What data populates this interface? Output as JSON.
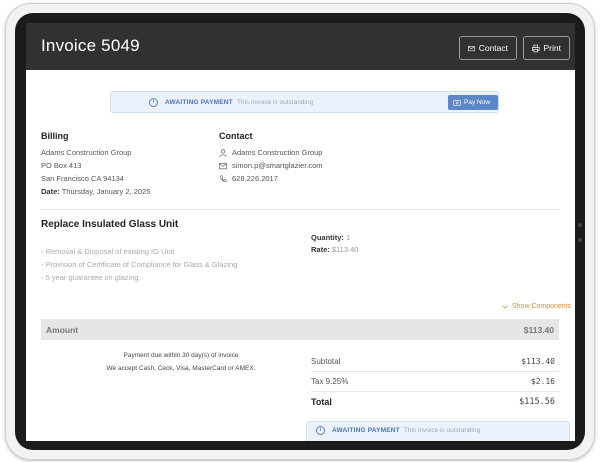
{
  "header": {
    "title": "Invoice 5049",
    "contact_label": "Contact",
    "print_label": "Print"
  },
  "status_banner": {
    "status": "AWAITING PAYMENT",
    "description": "This invoice is outstanding",
    "pay_label": "Pay Now"
  },
  "billing": {
    "heading": "Billing",
    "name": "Adams Construction Group",
    "address1": "PO Box 413",
    "address2": "San Francisco CA 94134",
    "date_label": "Date:",
    "date_value": "Thursday, January 2, 2025"
  },
  "contact": {
    "heading": "Contact",
    "company": "Adams Construction Group",
    "email": "simon.p@smartglazier.com",
    "phone": "628.226.2017"
  },
  "line_item": {
    "title": "Replace Insulated Glass Unit",
    "descriptions": [
      "- Removal & Disposal of existing IG Unit",
      "- Provision of Certificate of Compliance for Glass & Glazing",
      "- 5 year guarantee on glazing"
    ],
    "quantity_label": "Quantity:",
    "quantity_value": "1",
    "rate_label": "Rate:",
    "rate_value": "$113.40",
    "show_components": "Show Components"
  },
  "amount": {
    "label": "Amount",
    "value": "$113.40"
  },
  "notes": {
    "payment_due": "Payment due within 30 day(s) of invoice",
    "accepted": "We accept Cash, Ceck, Visa, MasterCard or AMEX."
  },
  "totals": {
    "subtotal_label": "Subtotal",
    "subtotal_value": "$113.40",
    "tax_label": "Tax 9.25%",
    "tax_value": "$2.16",
    "total_label": "Total",
    "total_value": "$115.56"
  },
  "icons": [
    "envelope-icon",
    "printer-icon",
    "info-icon",
    "credit-card-icon",
    "user-icon",
    "phone-icon",
    "chevron-down-icon"
  ],
  "colors": {
    "header_bg": "#2f3133",
    "accent_blue": "#5b86c8",
    "status_blue": "#4a72b8",
    "banner_bg": "#ebf2fb",
    "show_components": "#d98a3a"
  }
}
